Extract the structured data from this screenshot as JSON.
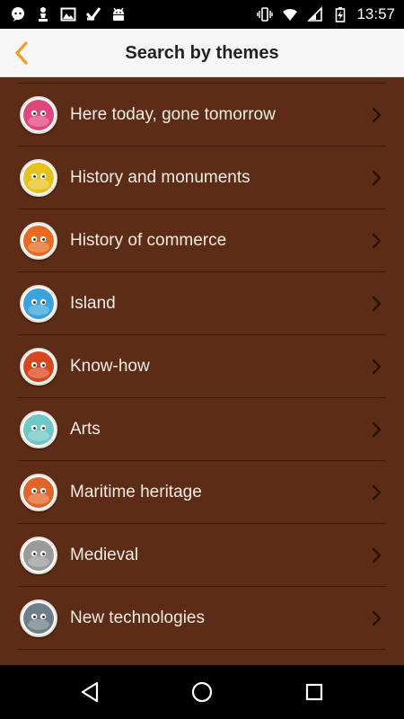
{
  "status_bar": {
    "time": "13:57",
    "left_icons": [
      "chat-bubble-icon",
      "chess-pawn-icon",
      "image-icon",
      "check-app-icon",
      "android-robot-icon"
    ],
    "right_icons": [
      "vibrate-icon",
      "wifi-icon",
      "signal-icon",
      "battery-charging-icon"
    ]
  },
  "header": {
    "title": "Search by themes",
    "back_icon": "chevron-left-icon",
    "accent_color": "#f39c1f"
  },
  "themes": [
    {
      "label": "Here today, gone tomorrow",
      "icon": "pink-pig-mascot-icon",
      "color": "#e0457b"
    },
    {
      "label": "History and monuments",
      "icon": "yellow-mascot-icon",
      "color": "#e8c21c"
    },
    {
      "label": "History of commerce",
      "icon": "orange-mascot-icon",
      "color": "#e66a1f"
    },
    {
      "label": "Island",
      "icon": "blue-island-mascot-icon",
      "color": "#3aa3dc"
    },
    {
      "label": "Know-how",
      "icon": "red-mascot-icon",
      "color": "#d8461f"
    },
    {
      "label": "Arts",
      "icon": "teal-mascot-icon",
      "color": "#6fc7c7"
    },
    {
      "label": "Maritime heritage",
      "icon": "octopus-mascot-icon",
      "color": "#e0642a"
    },
    {
      "label": "Medieval",
      "icon": "knight-helmet-mascot-icon",
      "color": "#9a9a9a"
    },
    {
      "label": "New technologies",
      "icon": "grey-mascot-icon",
      "color": "#6f7f8a"
    }
  ],
  "nav": {
    "back": "nav-back-icon",
    "home": "nav-home-icon",
    "recents": "nav-recents-icon"
  },
  "colors": {
    "list_background": "#5c2c17",
    "divider": "#3a1a0b",
    "text": "#f3ece6"
  }
}
